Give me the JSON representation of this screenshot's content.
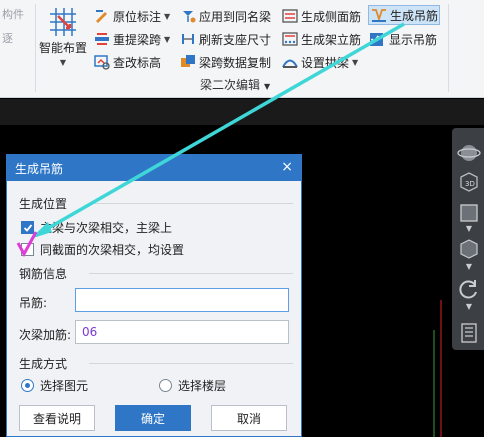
{
  "ribbon": {
    "left_stub": [
      "构件",
      "逐"
    ],
    "smart_layout": "智能布置",
    "col1": [
      "原位标注",
      "重提梁跨",
      "查改标高"
    ],
    "col2": [
      "应用到同名梁",
      "刷新支座尺寸",
      "梁跨数据复制"
    ],
    "col3": [
      "生成侧面筋",
      "生成架立筋",
      "设置拱梁"
    ],
    "col4": [
      "生成吊筋",
      "显示吊筋"
    ],
    "group_label": "梁二次编辑"
  },
  "dialog": {
    "title": "生成吊筋",
    "close": "×",
    "section_position": "生成位置",
    "option1": "主梁与次梁相交，主梁上",
    "option2": "同截面的次梁相交，均设置",
    "section_rebar": "钢筋信息",
    "hanger_label": "吊筋:",
    "hanger_value": "",
    "secondary_label": "次梁加筋:",
    "secondary_value": "06",
    "section_mode": "生成方式",
    "mode_selected": "选择图元",
    "mode_floor": "选择楼层",
    "btn_help": "查看说明",
    "btn_ok": "确定",
    "btn_cancel": "取消"
  },
  "colors": {
    "accent": "#2f77c6",
    "annotation_arrow": "#3fd6d8",
    "annotation_mark": "#e03ad8"
  },
  "icons": [
    "smart-layout-icon",
    "in-situ-annotation-icon",
    "re-extract-span-icon",
    "check-elevation-icon",
    "apply-same-name-icon",
    "refresh-support-icon",
    "copy-span-data-icon",
    "side-rebar-icon",
    "erection-rebar-icon",
    "arch-beam-icon",
    "hanger-rebar-icon",
    "view-orbit-icon",
    "view-3d-icon",
    "view-box-icon",
    "view-cube-icon",
    "view-rotate-icon",
    "view-grid-icon"
  ]
}
